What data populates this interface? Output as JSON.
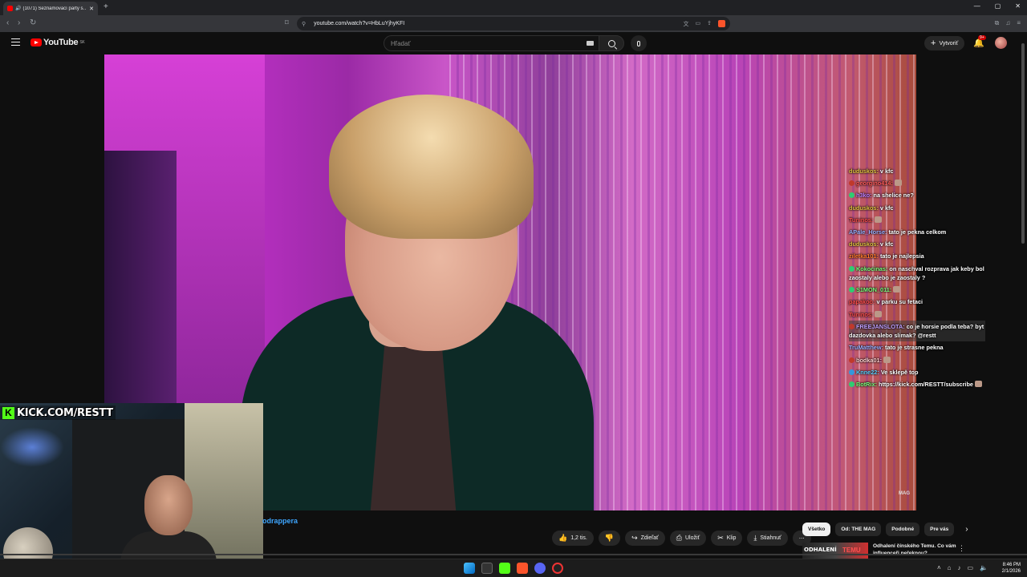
{
  "browser": {
    "tab_title": "(1071) Seznamovací party s…",
    "tab_close": "✕",
    "new_tab": "+",
    "url": "youtube.com/watch?v=HbLuYjhyKFI",
    "window_controls": [
      "—",
      "▢",
      "✕"
    ]
  },
  "youtube": {
    "logo_text": "YouTube",
    "country_code": "SK",
    "search_placeholder": "Hľadať",
    "create_label": "Vytvoriť",
    "notif_badge": "9+"
  },
  "video": {
    "watermark": "MAG"
  },
  "overlay": {
    "kick_letter": "K",
    "kick_text": "KICK.COM/RESTT"
  },
  "chat": [
    {
      "user": "duduskos:",
      "color": "#e0c040",
      "text": " v kfc",
      "badge": "",
      "emote": false
    },
    {
      "user": "georgino414:",
      "color": "#ff5a5a",
      "text": "",
      "badge": "#c0392b",
      "emote": true
    },
    {
      "user": "h3ko:",
      "color": "#c080ff",
      "text": " na shelice ne?",
      "badge": "#2ecc71",
      "emote": false
    },
    {
      "user": "duduskos:",
      "color": "#e0c040",
      "text": " v kfc",
      "badge": "",
      "emote": false
    },
    {
      "user": "Tuninos:",
      "color": "#ff4d4d",
      "text": "",
      "badge": "",
      "emote": true
    },
    {
      "user": "APale_Horse:",
      "color": "#9ab0ff",
      "text": " tato je pekna celkom",
      "badge": "",
      "emote": false
    },
    {
      "user": "duduskos:",
      "color": "#e0c040",
      "text": " v kfc",
      "badge": "",
      "emote": false
    },
    {
      "user": "ziletka101:",
      "color": "#ff7a2a",
      "text": " tato je najlepsia",
      "badge": "",
      "emote": false
    },
    {
      "user": "Kokocinas:",
      "color": "#7dff7d",
      "text": " on naschval rozprava jak keby bol zaostaly alebo je zaostaly ?",
      "badge": "#2ecc71",
      "emote": false
    },
    {
      "user": "S1MON_011:",
      "color": "#7dff7d",
      "text": "",
      "badge": "#2ecc71",
      "emote": true
    },
    {
      "user": "papakoo:",
      "color": "#ff4d4d",
      "text": " v parku su fetaci",
      "badge": "",
      "emote": false
    },
    {
      "user": "Tuninos:",
      "color": "#ff4d4d",
      "text": "",
      "badge": "",
      "emote": true
    },
    {
      "user": "FREEJANSLOTA:",
      "color": "#c0a0ff",
      "text": " co je horsie podla teba? byt dazdovka alebo slimak? @restt",
      "badge": "#c0392b",
      "emote": false,
      "highlight": true
    },
    {
      "user": "TruMatthew:",
      "color": "#9ab0ff",
      "text": " tato je strasne pekna",
      "badge": "",
      "emote": false
    },
    {
      "user": "bodka01:",
      "color": "#ffd0d0",
      "text": "",
      "badge": "#c0392b",
      "emote": true
    },
    {
      "user": "Knne22:",
      "color": "#5ad1ff",
      "text": " Ve sklepě top",
      "badge": "#3498db",
      "emote": false
    },
    {
      "user": "BotRix:",
      "color": "#7dff7d",
      "text": " https://kick.com/RESTT/subscribe",
      "badge": "#2ecc71",
      "emote": true
    }
  ],
  "below": {
    "channel_fragment": "odrappera",
    "like_count": "1,2 tis.",
    "share_label": "Zdieľať",
    "save_label": "Uložiť",
    "clip_label": "Klip",
    "download_label": "Stiahnuť",
    "more_label": "⋯",
    "chips": [
      "Všetko",
      "Od: THE MAG",
      "Podobné",
      "Pre vás"
    ],
    "reco_thumb_left": "ODHALENÍ",
    "reco_thumb_right": "TEMU",
    "reco_title": "Odhalení čínského Temu. Co vám influenceři neřeknou?"
  },
  "taskbar": {
    "time": "8:46 PM",
    "date": "2/1/2026"
  }
}
